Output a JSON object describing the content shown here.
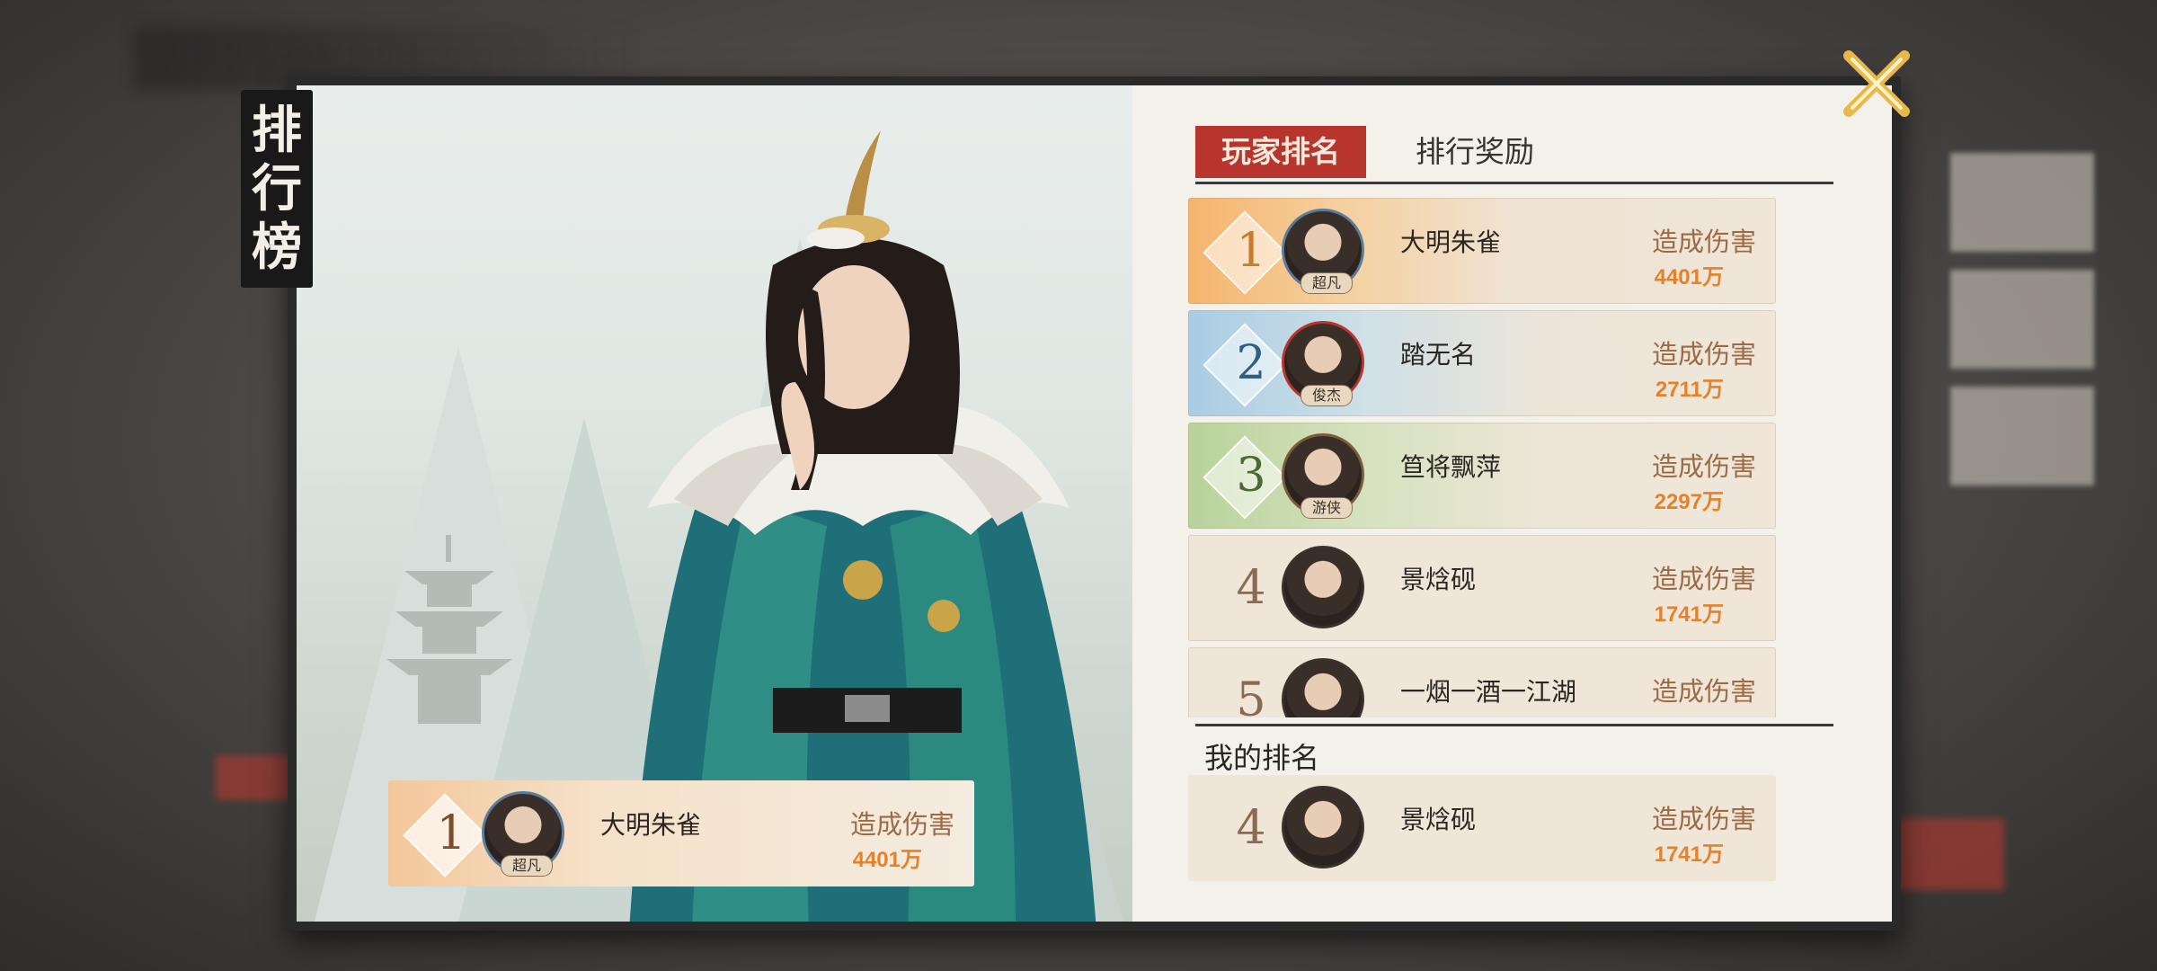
{
  "title_chars": [
    "排",
    "行",
    "榜"
  ],
  "tabs": {
    "active": "玩家排名",
    "inactive": "排行奖励"
  },
  "ranking": [
    {
      "rank": "1",
      "name": "大明朱雀",
      "badge": "超凡",
      "damage_label": "造成伤害",
      "damage": "4401万"
    },
    {
      "rank": "2",
      "name": "踏无名",
      "badge": "俊杰",
      "damage_label": "造成伤害",
      "damage": "2711万"
    },
    {
      "rank": "3",
      "name": "笪将飘萍",
      "badge": "游侠",
      "damage_label": "造成伤害",
      "damage": "2297万"
    },
    {
      "rank": "4",
      "name": "景焓砚",
      "badge": "",
      "damage_label": "造成伤害",
      "damage": "1741万"
    },
    {
      "rank": "5",
      "name": "一烟一酒一江湖",
      "badge": "",
      "damage_label": "造成伤害",
      "damage": ""
    }
  ],
  "my_rank": {
    "label": "我的排名",
    "rank": "4",
    "name": "景焓砚",
    "damage_label": "造成伤害",
    "damage": "1741万"
  },
  "featured": {
    "rank": "1",
    "name": "大明朱雀",
    "badge": "超凡",
    "damage_label": "造成伤害",
    "damage": "4401万"
  },
  "colors": {
    "accent_red": "#b8352d",
    "damage_orange": "#e3822b",
    "panel_bg": "#f4f1ea"
  }
}
